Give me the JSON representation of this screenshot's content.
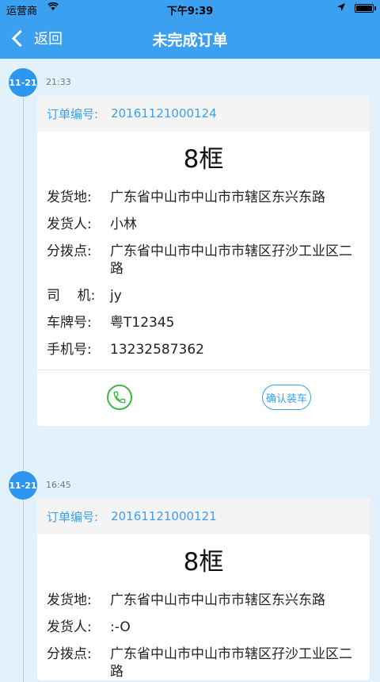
{
  "status_bar": {
    "carrier": "运营商",
    "time": "下午9:39",
    "battery_level": 1.0
  },
  "nav": {
    "back_label": "返回",
    "title": "未完成订单"
  },
  "orders": [
    {
      "date": "11-21",
      "time": "21:33",
      "order_label": "订单编号:",
      "order_no": "20161121000124",
      "quantity": "8框",
      "fields": [
        {
          "label": "发货地:",
          "value": "广东省中山市中山市市辖区东兴东路"
        },
        {
          "label": "发货人:",
          "value": "小林"
        },
        {
          "label": "分拨点:",
          "value": "广东省中山市中山市市辖区孖沙工业区二路"
        },
        {
          "label": "司    机:",
          "value": "jy"
        },
        {
          "label": "车牌号:",
          "value": "粤T12345"
        },
        {
          "label": "手机号:",
          "value": "13232587362"
        }
      ],
      "confirm_label": "确认装车"
    },
    {
      "date": "11-21",
      "time": "16:45",
      "order_label": "订单编号:",
      "order_no": "20161121000121",
      "quantity": "8框",
      "fields": [
        {
          "label": "发货地:",
          "value": "广东省中山市中山市市辖区东兴东路"
        },
        {
          "label": "发货人:",
          "value": ":-O"
        },
        {
          "label": "分拨点:",
          "value": "广东省中山市中山市市辖区孖沙工业区二路"
        }
      ]
    }
  ]
}
